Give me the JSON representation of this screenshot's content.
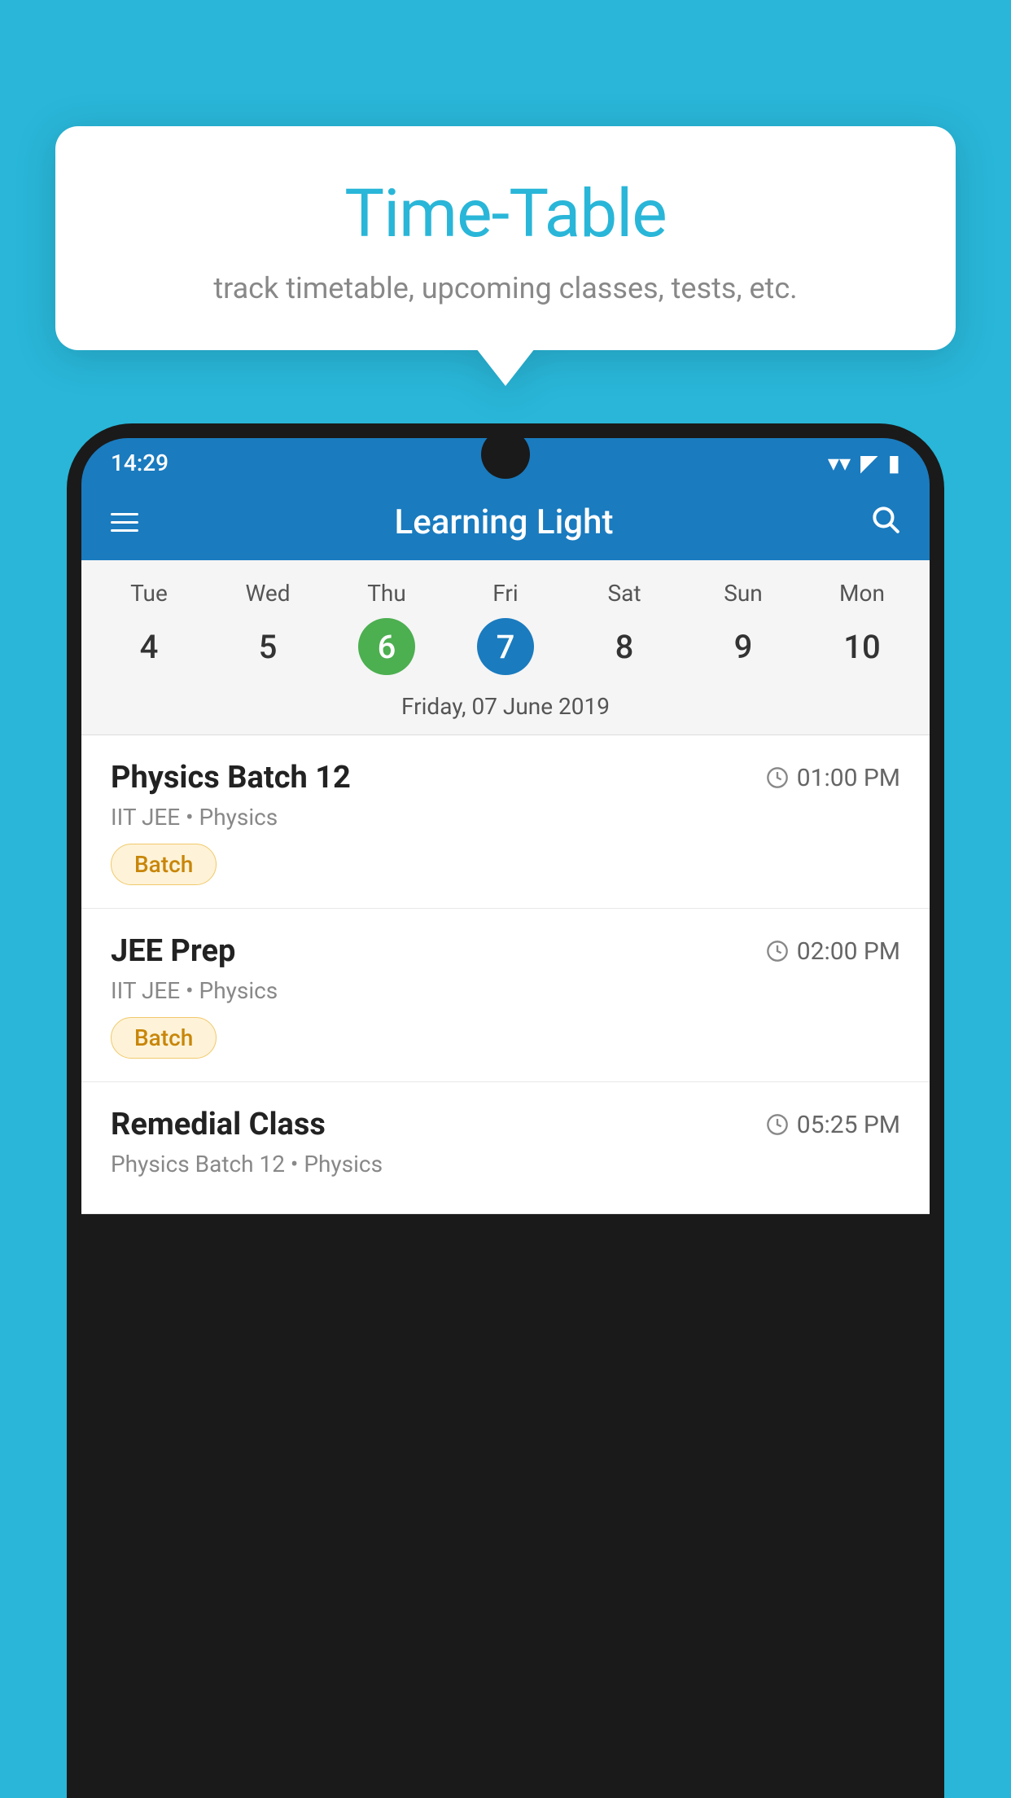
{
  "background_color": "#29b6d8",
  "tooltip": {
    "title": "Time-Table",
    "subtitle": "track timetable, upcoming classes, tests, etc."
  },
  "phone": {
    "time": "14:29",
    "app_title": "Learning Light",
    "selected_date_label": "Friday, 07 June 2019",
    "days": [
      {
        "label": "Tue",
        "num": "4"
      },
      {
        "label": "Wed",
        "num": "5"
      },
      {
        "label": "Thu",
        "num": "6",
        "state": "today"
      },
      {
        "label": "Fri",
        "num": "7",
        "state": "selected"
      },
      {
        "label": "Sat",
        "num": "8"
      },
      {
        "label": "Sun",
        "num": "9"
      },
      {
        "label": "Mon",
        "num": "10"
      }
    ],
    "schedule_items": [
      {
        "name": "Physics Batch 12",
        "time": "01:00 PM",
        "sub": "IIT JEE • Physics",
        "badge": "Batch"
      },
      {
        "name": "JEE Prep",
        "time": "02:00 PM",
        "sub": "IIT JEE • Physics",
        "badge": "Batch"
      },
      {
        "name": "Remedial Class",
        "time": "05:25 PM",
        "sub": "Physics Batch 12 • Physics",
        "badge": null
      }
    ]
  }
}
